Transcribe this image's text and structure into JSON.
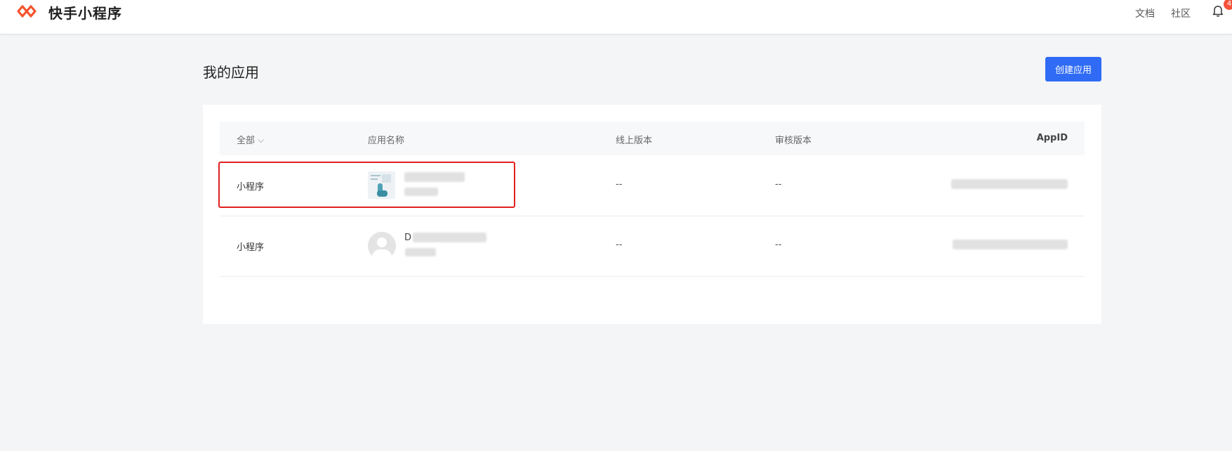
{
  "header": {
    "brand": "快手小程序",
    "nav": [
      {
        "label": "文档"
      },
      {
        "label": "社区"
      }
    ],
    "notification_count": "4"
  },
  "main": {
    "title": "我的应用",
    "create_button": "创建应用"
  },
  "table": {
    "columns": {
      "type": "全部",
      "name": "应用名称",
      "online_version": "线上版本",
      "review_version": "审核版本",
      "appid": "AppID"
    },
    "rows": [
      {
        "type": "小程序",
        "name_partial": "",
        "online_version": "--",
        "review_version": "--"
      },
      {
        "type": "小程序",
        "name_partial": "D",
        "online_version": "--",
        "review_version": "--"
      }
    ]
  },
  "colors": {
    "accent": "#2f6bf5",
    "brand_orange": "#f5522d",
    "highlight": "#e02020"
  }
}
